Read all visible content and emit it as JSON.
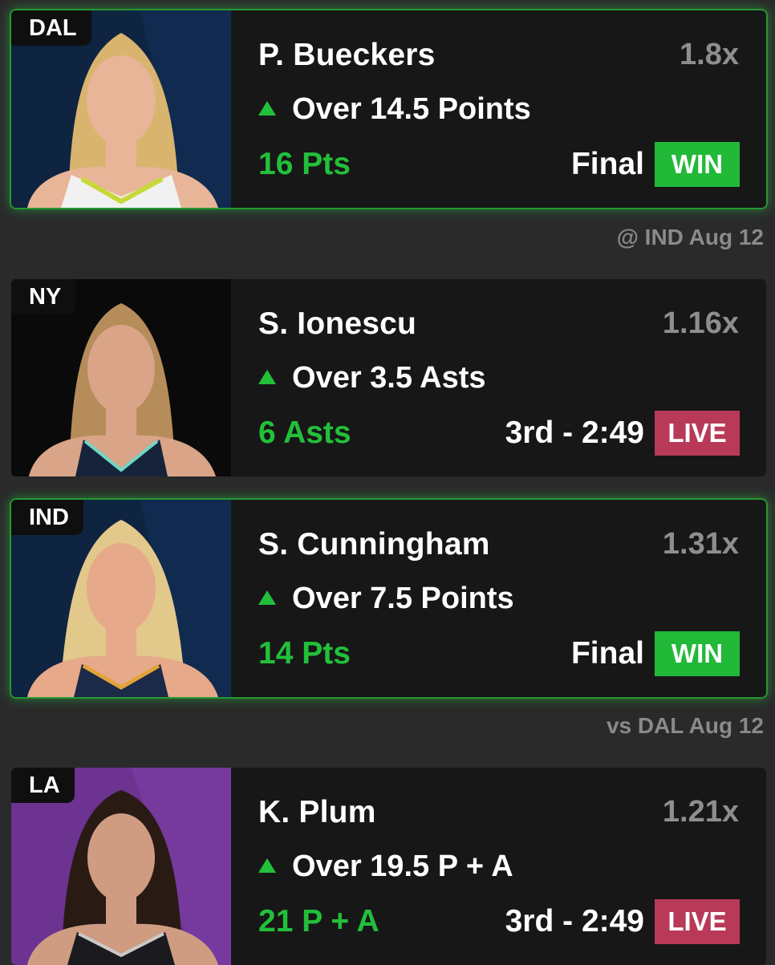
{
  "picks": [
    {
      "team": "DAL",
      "player": "P. Bueckers",
      "multiplier": "1.8x",
      "line": "Over 14.5 Points",
      "stat": "16 Pts",
      "status": "Final",
      "badge": "WIN",
      "colors": {
        "bg": "#0e2440",
        "hair": "#d9b46e",
        "skin": "#e8b598",
        "jersey": "#f1f1f1"
      }
    },
    {
      "team": "NY",
      "player": "S. Ionescu",
      "multiplier": "1.16x",
      "line": "Over 3.5 Asts",
      "stat": "6 Asts",
      "status": "3rd - 2:49",
      "badge": "LIVE",
      "colors": {
        "bg": "#0a0a0a",
        "hair": "#b68d5a",
        "skin": "#d9a487",
        "jersey": "#16233a"
      }
    },
    {
      "team": "IND",
      "player": "S. Cunningham",
      "multiplier": "1.31x",
      "line": "Over 7.5 Points",
      "stat": "14 Pts",
      "status": "Final",
      "badge": "WIN",
      "colors": {
        "bg": "#0e2440",
        "hair": "#e3c88c",
        "skin": "#e6a989",
        "jersey": "#1b2a48"
      }
    },
    {
      "team": "LA",
      "player": "K. Plum",
      "multiplier": "1.21x",
      "line": "Over 19.5 P + A",
      "stat": "21 P + A",
      "status": "3rd - 2:49",
      "badge": "LIVE",
      "colors": {
        "bg": "#6c3391",
        "hair": "#2a1a14",
        "skin": "#cf9c82",
        "jersey": "#1b1b1f"
      }
    }
  ],
  "game_info": [
    "@ IND Aug 12",
    "vs DAL Aug 12"
  ],
  "theme": {
    "win": "#22b838",
    "live": "#b83a58",
    "accent_green": "#22c03a",
    "multiplier": "#8e8e8e"
  }
}
